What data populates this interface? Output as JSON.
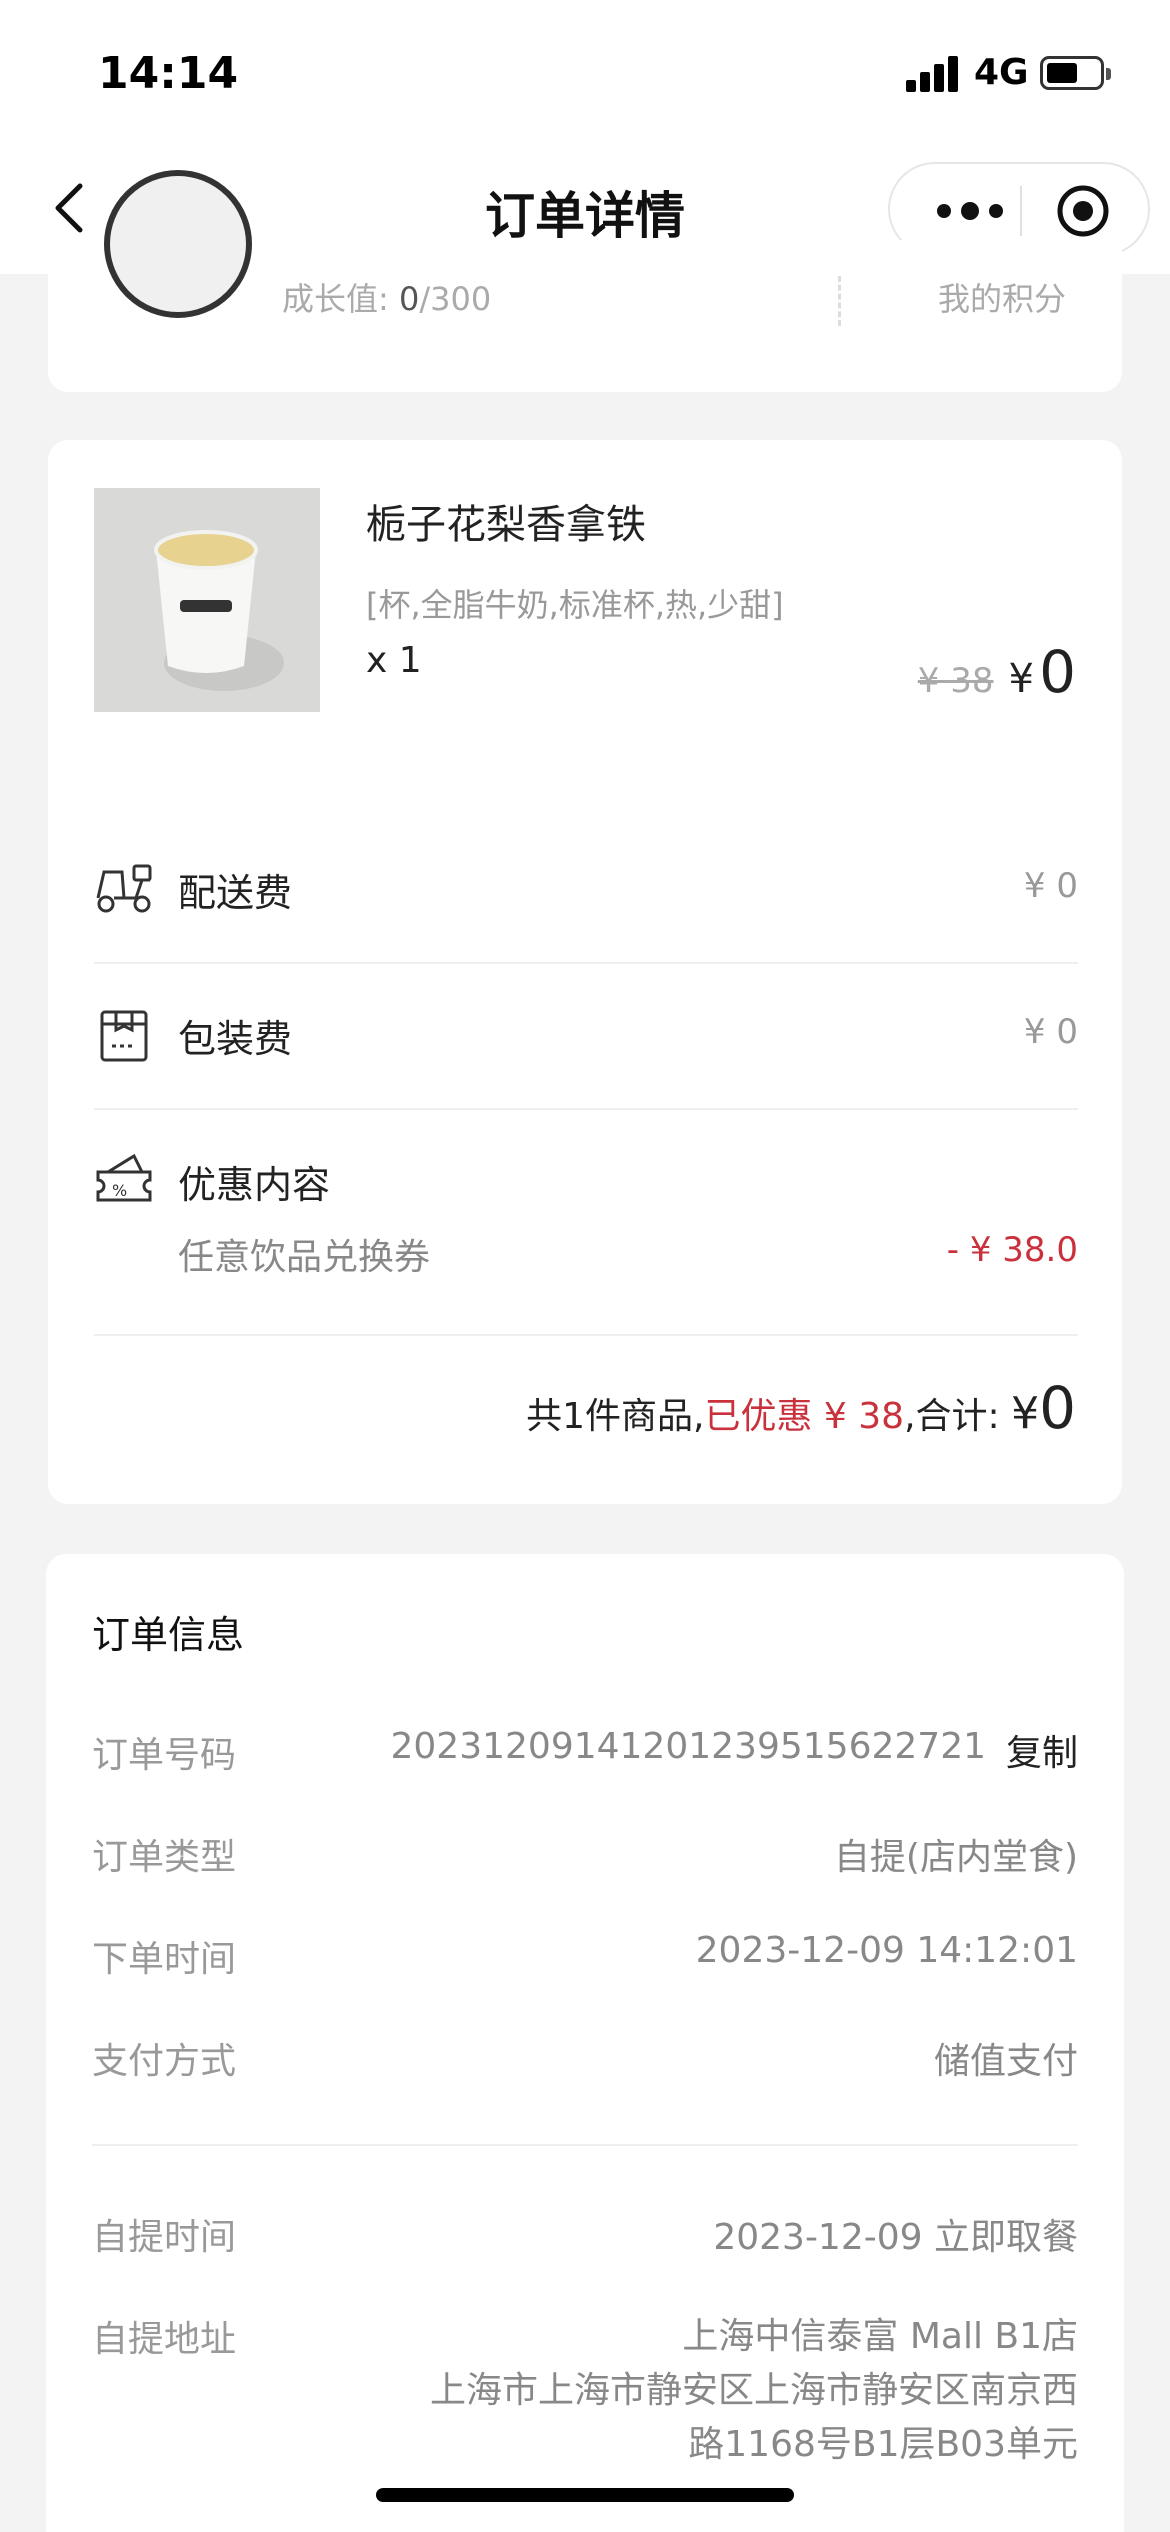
{
  "status_bar": {
    "time": "14:14",
    "network": "4G"
  },
  "nav": {
    "title": "订单详情"
  },
  "member": {
    "growth_label": "成长值:",
    "growth_current": "0",
    "growth_total": "/300",
    "points_label": "我的积分"
  },
  "product": {
    "name": "栀子花梨香拿铁",
    "spec": "[杯,全脂牛奶,标准杯,热,少甜]",
    "qty": "x 1",
    "price_original": "¥ 38",
    "price_currency": "¥",
    "price_final": "0"
  },
  "fees": [
    {
      "label": "配送费",
      "value": "¥ 0",
      "icon": "scooter-icon"
    },
    {
      "label": "包装费",
      "value": "¥ 0",
      "icon": "package-bag-icon"
    }
  ],
  "discount": {
    "label": "优惠内容",
    "name": "任意饮品兑换券",
    "value": "- ¥ 38.0",
    "icon": "coupon-percent-icon"
  },
  "summary": {
    "count_text": "共1件商品,",
    "discount_text": "已优惠 ¥ 38",
    "total_label": ",合计:",
    "currency": "¥",
    "total": "0"
  },
  "order_info": {
    "title": "订单信息",
    "rows": [
      {
        "label": "订单号码",
        "value": "2023120914120123951562272​1",
        "action": "复制"
      },
      {
        "label": "订单类型",
        "value": "自提(店内堂食)"
      },
      {
        "label": "下单时间",
        "value": "2023-12-09 14:12:01"
      },
      {
        "label": "支付方式",
        "value": "储值支付"
      }
    ],
    "pickup_time_label": "自提时间",
    "pickup_time": "2023-12-09 立即取餐",
    "pickup_addr_label": "自提地址",
    "pickup_addr": [
      "上海中信泰富 Mall B1店",
      "上海市上海市静安区上海市静安区南京西",
      "路1168号B1层B03单元"
    ]
  },
  "colors": {
    "accent_red": "#c9323c",
    "bg": "#f3f3f3"
  }
}
